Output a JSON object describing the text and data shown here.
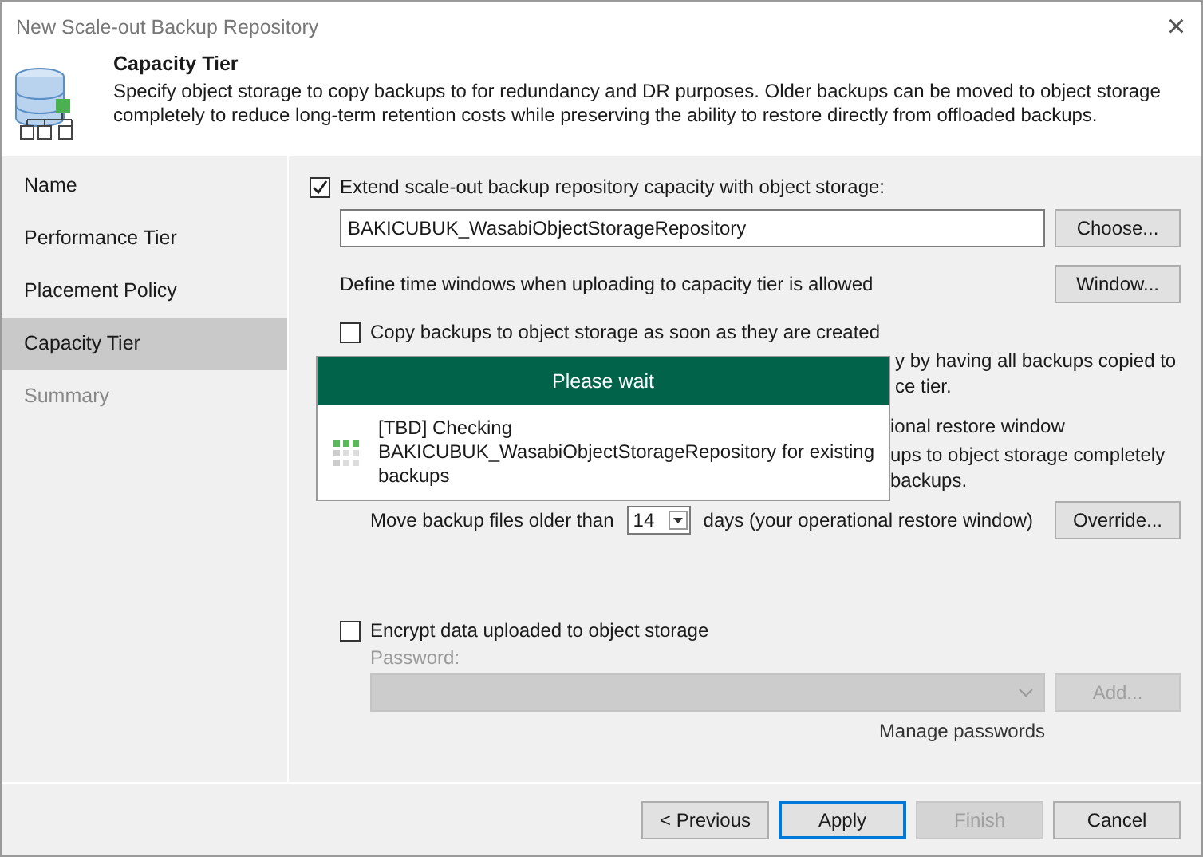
{
  "window": {
    "title": "New Scale-out Backup Repository",
    "close": "×"
  },
  "header": {
    "title": "Capacity Tier",
    "description": "Specify object storage to copy backups to for redundancy and DR purposes. Older backups can be moved to object storage completely to reduce long-term retention costs while preserving the ability to restore directly from offloaded backups."
  },
  "sidebar": {
    "items": [
      {
        "label": "Name",
        "selected": false,
        "disabled": false
      },
      {
        "label": "Performance Tier",
        "selected": false,
        "disabled": false
      },
      {
        "label": "Placement Policy",
        "selected": false,
        "disabled": false
      },
      {
        "label": "Capacity Tier",
        "selected": true,
        "disabled": false
      },
      {
        "label": "Summary",
        "selected": false,
        "disabled": true
      }
    ]
  },
  "content": {
    "extend": {
      "label": "Extend scale-out backup repository capacity with object storage:",
      "checked": true
    },
    "repository": {
      "value": "BAKICUBUK_WasabiObjectStorageRepository",
      "button": "Choose..."
    },
    "time_windows": {
      "label": "Define time windows when uploading to capacity tier is allowed",
      "button": "Window..."
    },
    "copy": {
      "label": "Copy backups to object storage as soon as they are created",
      "checked": false
    },
    "copy_note": [
      "y by having all backups copied to",
      "ce tier."
    ],
    "move_note": [
      "ional restore window",
      "ups to object storage completely",
      "backups."
    ],
    "move": {
      "label": "Move backup files older than",
      "value": "14",
      "suffix": "days (your operational restore window)",
      "button": "Override..."
    },
    "encrypt": {
      "label": "Encrypt data uploaded to object storage",
      "checked": false
    },
    "password": {
      "label": "Password:",
      "disabled": true
    },
    "add_button": {
      "label": "Add...",
      "disabled": true
    },
    "manage_link": "Manage passwords"
  },
  "dialog": {
    "title": "Please wait",
    "message": "[TBD] Checking BAKICUBUK_WasabiObjectStorageRepository for existing backups"
  },
  "buttons": [
    {
      "label": "< Previous",
      "kind": "normal",
      "disabled": false
    },
    {
      "label": "Apply",
      "kind": "default",
      "disabled": false
    },
    {
      "label": "Finish",
      "kind": "normal",
      "disabled": true
    },
    {
      "label": "Cancel",
      "kind": "normal",
      "disabled": false
    }
  ]
}
